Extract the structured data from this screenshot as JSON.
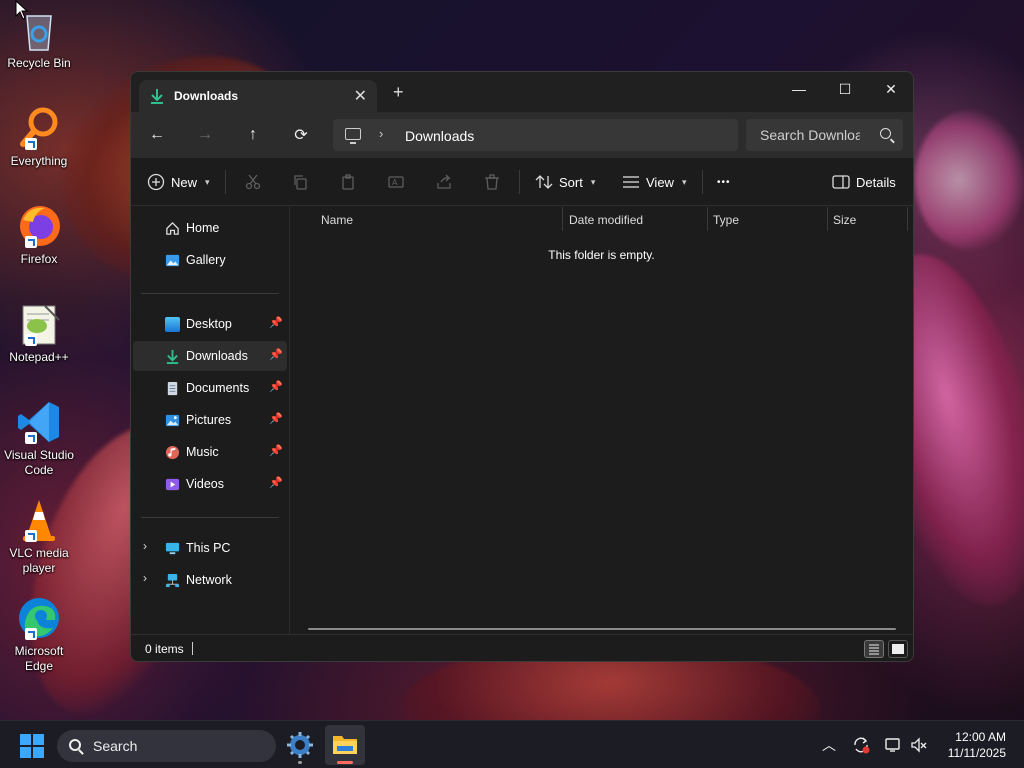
{
  "desktop": {
    "icons": [
      {
        "label": "Recycle Bin"
      },
      {
        "label": "Everything"
      },
      {
        "label": "Firefox"
      },
      {
        "label": "Notepad++"
      },
      {
        "label": "Visual Studio Code"
      },
      {
        "label": "VLC media player"
      },
      {
        "label": "Microsoft Edge"
      }
    ]
  },
  "window": {
    "tab": {
      "title": "Downloads",
      "close_glyph": "✕"
    },
    "new_tab_glyph": "+",
    "controls": {
      "minimize": "—",
      "maximize": "☐",
      "close": "✕"
    },
    "nav": {
      "back": "←",
      "forward": "→",
      "up": "↑",
      "refresh": "⟳"
    },
    "address": {
      "separator": "›",
      "crumb": "Downloads"
    },
    "search": {
      "placeholder": "Search Downloads"
    },
    "toolbar": {
      "new_label": "New",
      "sort_label": "Sort",
      "view_label": "View",
      "more_glyph": "•••",
      "details_label": "Details"
    },
    "sidebar": {
      "top": [
        {
          "label": "Home"
        },
        {
          "label": "Gallery"
        }
      ],
      "quick": [
        {
          "label": "Desktop"
        },
        {
          "label": "Downloads"
        },
        {
          "label": "Documents"
        },
        {
          "label": "Pictures"
        },
        {
          "label": "Music"
        },
        {
          "label": "Videos"
        }
      ],
      "tree": [
        {
          "label": "This PC"
        },
        {
          "label": "Network"
        }
      ],
      "pin_glyph": "📌",
      "expand_glyph": "›"
    },
    "columns": [
      "Name",
      "Date modified",
      "Type",
      "Size"
    ],
    "empty_message": "This folder is empty.",
    "status": {
      "items": "0 items"
    }
  },
  "taskbar": {
    "search_label": "Search",
    "clock": {
      "time": "12:00 AM",
      "date": "11/11/2025"
    }
  },
  "colors": {
    "accent": "#3aa8ff",
    "downloads_green": "#2fbf8f",
    "window_bg": "#1c1c1c"
  }
}
